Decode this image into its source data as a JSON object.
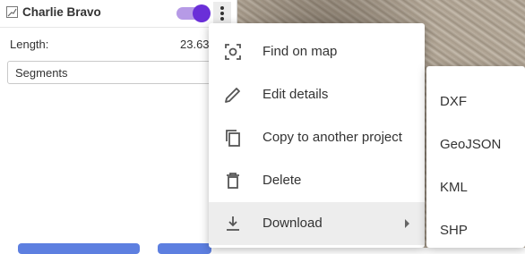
{
  "feature": {
    "name": "Charlie Bravo",
    "visible_toggle": true,
    "length_label": "Length:",
    "length_value": "23.63",
    "display_mode": "Segments"
  },
  "context_menu": {
    "items": [
      {
        "label": "Find on map",
        "icon": "find-on-map-icon"
      },
      {
        "label": "Edit details",
        "icon": "pencil-icon"
      },
      {
        "label": "Copy to another project",
        "icon": "copy-icon"
      },
      {
        "label": "Delete",
        "icon": "trash-icon"
      },
      {
        "label": "Download",
        "icon": "download-icon",
        "active": true,
        "has_submenu": true
      }
    ]
  },
  "download_submenu": {
    "items": [
      {
        "label": "DXF"
      },
      {
        "label": "GeoJSON"
      },
      {
        "label": "KML"
      },
      {
        "label": "SHP"
      }
    ]
  },
  "colors": {
    "toggle_knob": "#6a2fd8",
    "toggle_track": "#b69ae6",
    "button": "#5d7fe0"
  }
}
